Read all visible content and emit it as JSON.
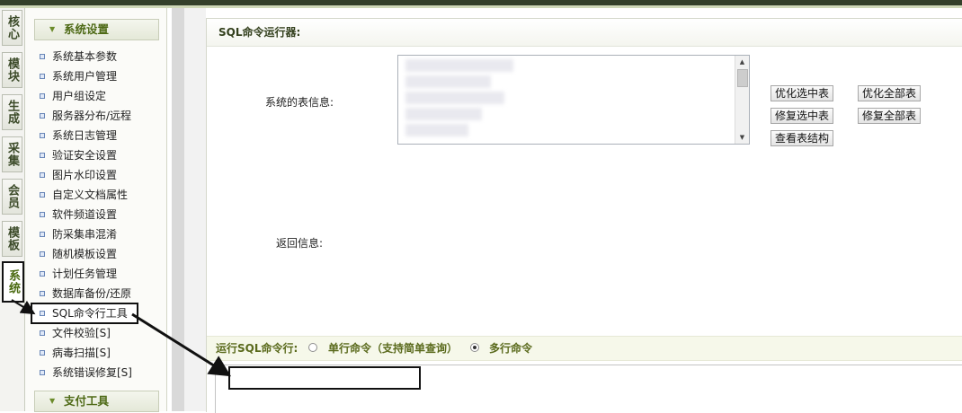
{
  "vertical_tabs": [
    {
      "label": "核心",
      "active": false
    },
    {
      "label": "模块",
      "active": false
    },
    {
      "label": "生成",
      "active": false
    },
    {
      "label": "采集",
      "active": false
    },
    {
      "label": "会员",
      "active": false
    },
    {
      "label": "模板",
      "active": false
    },
    {
      "label": "系统",
      "active": true
    }
  ],
  "sidebar": {
    "group1": "系统设置",
    "items": [
      "系统基本参数",
      "系统用户管理",
      "用户组设定",
      "服务器分布/远程",
      "系统日志管理",
      "验证安全设置",
      "图片水印设置",
      "自定义文档属性",
      "软件频道设置",
      "防采集串混淆",
      "随机模板设置",
      "计划任务管理",
      "数据库备份/还原",
      "SQL命令行工具",
      "文件校验[S]",
      "病毒扫描[S]",
      "系统错误修复[S]"
    ],
    "highlighted_item": "SQL命令行工具",
    "group2": "支付工具"
  },
  "panel": {
    "title": "SQL命令运行器:",
    "table_info_label": "系统的表信息:",
    "return_info_label": "返回信息:",
    "buttons": {
      "optimize_selected": "优化选中表",
      "optimize_all": "优化全部表",
      "repair_selected": "修复选中表",
      "repair_all": "修复全部表",
      "view_structure": "查看表结构"
    },
    "run_label": "运行SQL命令行:",
    "mode_single": "单行命令（支持简单查询）",
    "mode_multi": "多行命令",
    "selected_mode": "多行命令"
  },
  "icons": {
    "bullet": "square-bullet-icon",
    "group_toggle": "triangle-down-icon",
    "scroll_up": "arrow-up-icon",
    "scroll_down": "arrow-down-icon"
  },
  "colors": {
    "accent": "#4e6a16",
    "cmdbar_bg": "#f6f8ea",
    "topbar": "#34402a"
  }
}
